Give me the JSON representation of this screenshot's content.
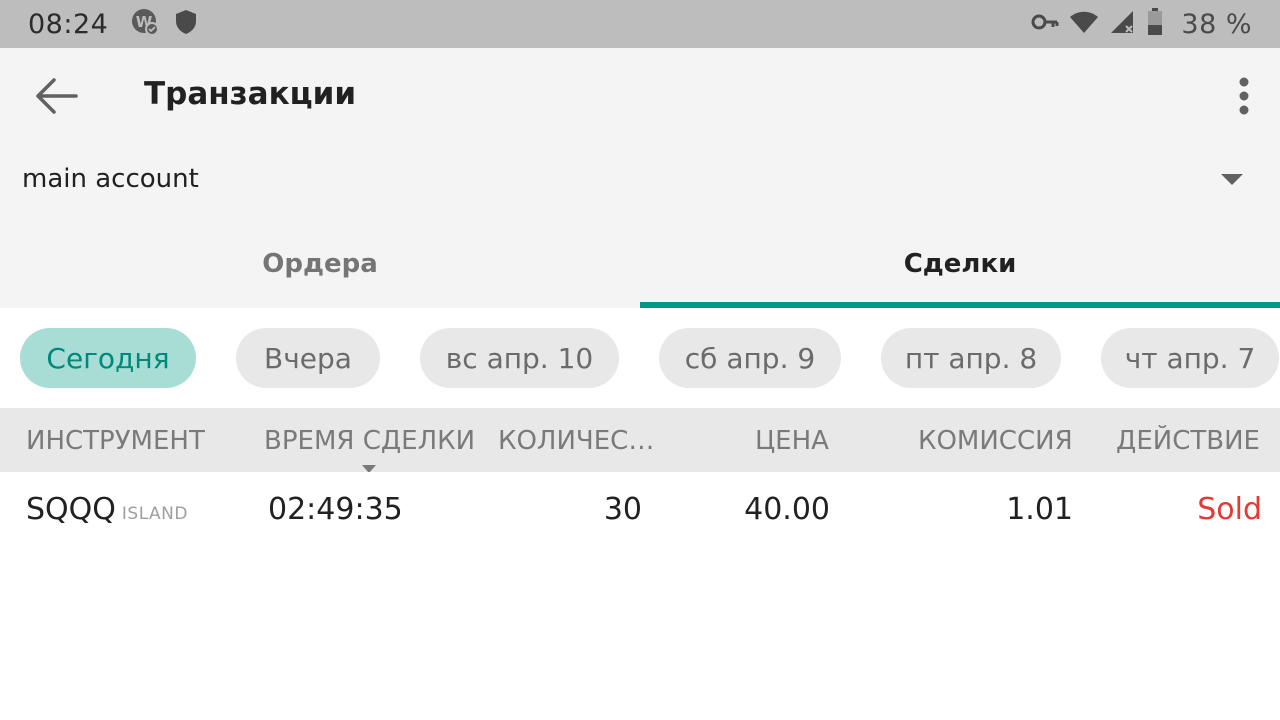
{
  "status_bar": {
    "time": "08:24",
    "left_icons": [
      "app-notification-icon",
      "shield-icon"
    ],
    "right_icons": [
      "vpn-key-icon",
      "wifi-icon",
      "cell-signal-icon",
      "battery-icon"
    ],
    "battery_percent": "38 %"
  },
  "toolbar": {
    "title": "Транзакции",
    "back_icon": "arrow-back-icon",
    "menu_icon": "more-vert-icon"
  },
  "account": {
    "selected": "main account"
  },
  "tabs": [
    {
      "label": "Ордера",
      "active": false
    },
    {
      "label": "Сделки",
      "active": true
    }
  ],
  "date_filters": [
    {
      "label": "Сегодня",
      "selected": true
    },
    {
      "label": "Вчера",
      "selected": false
    },
    {
      "label": "вс апр. 10",
      "selected": false
    },
    {
      "label": "сб апр. 9",
      "selected": false
    },
    {
      "label": "пт апр. 8",
      "selected": false
    },
    {
      "label": "чт апр. 7",
      "selected": false
    }
  ],
  "table": {
    "columns": [
      "ИНСТРУМЕНТ",
      "ВРЕМЯ СДЕЛКИ",
      "КОЛИЧЕС…",
      "ЦЕНА",
      "КОМИССИЯ",
      "ДЕЙСТВИЕ"
    ],
    "rows": [
      {
        "symbol": "SQQQ",
        "exchange": "ISLAND",
        "time": "02:49:35",
        "quantity": "30",
        "price": "40.00",
        "commission": "1.01",
        "action": "Sold"
      }
    ]
  },
  "colors": {
    "accent": "#009688",
    "chip_selected_bg": "#a7ddd5",
    "chip_selected_text": "#00897b",
    "sold": "#e53935",
    "status_bar": "#bdbdbd"
  }
}
